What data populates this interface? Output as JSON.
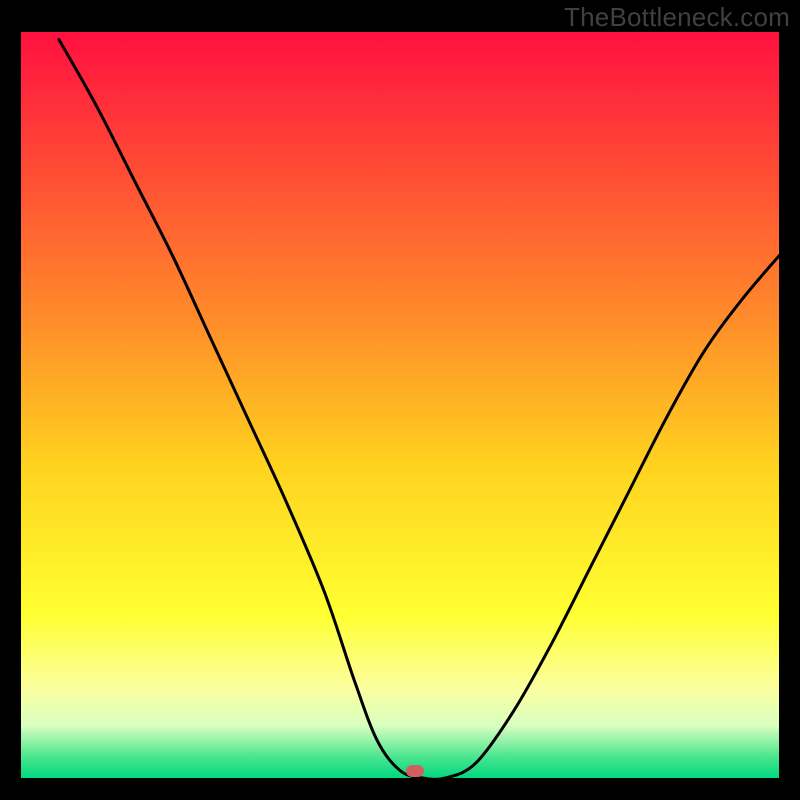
{
  "watermark": "TheBottleneck.com",
  "chart_data": {
    "type": "line",
    "title": "",
    "xlabel": "",
    "ylabel": "",
    "xlim": [
      0,
      100
    ],
    "ylim": [
      0,
      100
    ],
    "grid": false,
    "background": "rainbow-vertical-gradient",
    "gradient_stops": [
      {
        "pct": 0,
        "color": "#ff1040"
      },
      {
        "pct": 18,
        "color": "#ff4a35"
      },
      {
        "pct": 38,
        "color": "#ff8a2a"
      },
      {
        "pct": 58,
        "color": "#ffd21f"
      },
      {
        "pct": 78,
        "color": "#ffff30"
      },
      {
        "pct": 88,
        "color": "#fbffa0"
      },
      {
        "pct": 93,
        "color": "#d8ffc0"
      },
      {
        "pct": 97,
        "color": "#50e690"
      },
      {
        "pct": 100,
        "color": "#00d880"
      }
    ],
    "series": [
      {
        "name": "bottleneck-curve",
        "x": [
          5,
          10,
          15,
          20,
          25,
          30,
          35,
          40,
          44,
          47,
          50,
          53,
          56,
          60,
          65,
          70,
          75,
          80,
          85,
          90,
          95,
          100
        ],
        "y": [
          99,
          90,
          80,
          70,
          59,
          48,
          37,
          25,
          13,
          5,
          1,
          0,
          0,
          2,
          9,
          18,
          28,
          38,
          48,
          57,
          64,
          70
        ]
      }
    ],
    "marker": {
      "x": 52,
      "y": 1,
      "color": "#d06060"
    }
  }
}
